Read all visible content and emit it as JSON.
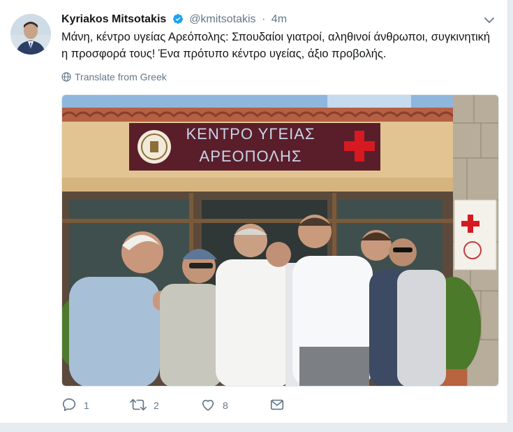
{
  "tweet": {
    "author_name": "Kyriakos Mitsotakis",
    "handle": "@kmitsotakis",
    "separator": "·",
    "time": "4m",
    "text": "Μάνη, κέντρο υγείας Αρεόπολης: Σπουδαίοι γιατροί, αληθινοί άνθρωποι, συγκινητική η προσφορά τους! Ένα πρότυπο κέντρο υγείας, άξιο προβολής.",
    "translate_label": "Translate from Greek",
    "photo": {
      "sign_line1": "ΚΕΝΤΡΟ ΥΓΕΙΑΣ",
      "sign_line2": "ΑΡΕΟΠΟΛΗΣ"
    },
    "actions": {
      "reply_count": "1",
      "retweet_count": "2",
      "like_count": "8"
    }
  },
  "colors": {
    "verified": "#1da1f2",
    "secondary_text": "#657786",
    "sign_bg": "#5a1e2a",
    "cross": "#d71920"
  }
}
